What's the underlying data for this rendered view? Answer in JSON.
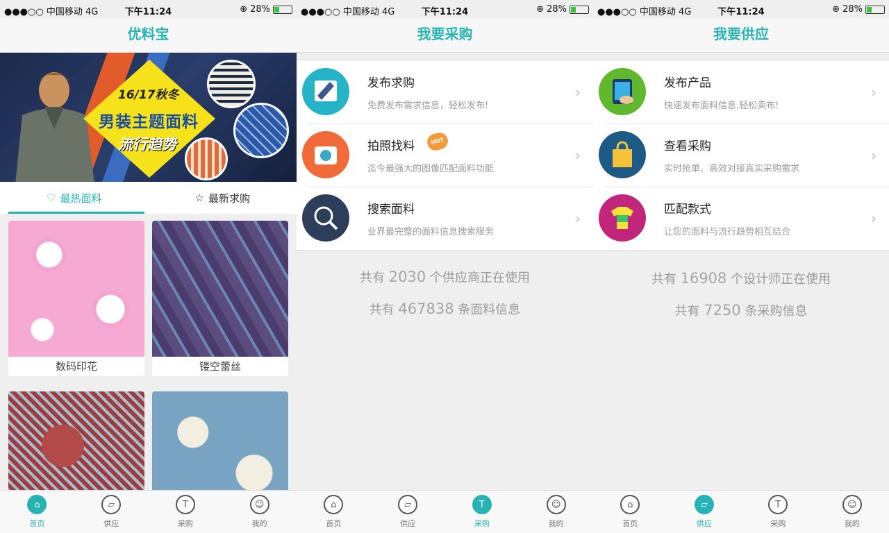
{
  "status": {
    "carrier": "●●●○○ 中国移动",
    "network": "4G",
    "time": "下午11:24",
    "battery": "28%",
    "battery_level": 0.28
  },
  "accent_color": "#27b3b3",
  "panel_home": {
    "title": "优料宝",
    "banner": {
      "season": "16/17秋冬",
      "headline": "男装主题面料",
      "tagline": "流行趋势"
    },
    "tabs": [
      {
        "label": "最热面料",
        "icon": "heart-icon",
        "active": true
      },
      {
        "label": "最新求购",
        "icon": "star-icon",
        "active": false
      }
    ],
    "products": [
      {
        "caption": "数码印花"
      },
      {
        "caption": "镂空蕾丝"
      },
      {
        "caption": ""
      },
      {
        "caption": ""
      }
    ]
  },
  "panel_buy": {
    "title": "我要采购",
    "items": [
      {
        "title": "发布求购",
        "subtitle": "免费发布需求信息，轻松发布!",
        "icon": "edit-icon",
        "color": "#27b3c7"
      },
      {
        "title": "拍照找料",
        "subtitle": "迄今最强大的图像匹配面料功能",
        "icon": "camera-icon",
        "color": "#f06a3a",
        "badge": "HOT"
      },
      {
        "title": "搜索面料",
        "subtitle": "业界最完整的面料信息搜索服务",
        "icon": "search-icon",
        "color": "#2c3e5a"
      }
    ],
    "stats": [
      {
        "prefix": "共有",
        "value": "2030",
        "suffix": "个供应商正在使用"
      },
      {
        "prefix": "共有",
        "value": "467838",
        "suffix": "条面料信息"
      }
    ]
  },
  "panel_supply": {
    "title": "我要供应",
    "items": [
      {
        "title": "发布产品",
        "subtitle": "快速发布面料信息,轻松卖布!",
        "icon": "tablet-icon",
        "color": "#5fb82e"
      },
      {
        "title": "查看采购",
        "subtitle": "实时抢单、高效对接真实采购需求",
        "icon": "shopping-bag-icon",
        "color": "#1e5a86"
      },
      {
        "title": "匹配款式",
        "subtitle": "让您的面料与流行趋势相互结合",
        "icon": "tshirt-icon",
        "color": "#c2267a"
      }
    ],
    "stats": [
      {
        "prefix": "共有",
        "value": "16908",
        "suffix": "个设计师正在使用"
      },
      {
        "prefix": "共有",
        "value": "7250",
        "suffix": "条采购信息"
      }
    ]
  },
  "nav": [
    {
      "label": "首页",
      "icon": "store-icon"
    },
    {
      "label": "供应",
      "icon": "fabric-icon"
    },
    {
      "label": "采购",
      "icon": "shirt-icon"
    },
    {
      "label": "我的",
      "icon": "user-icon"
    }
  ]
}
